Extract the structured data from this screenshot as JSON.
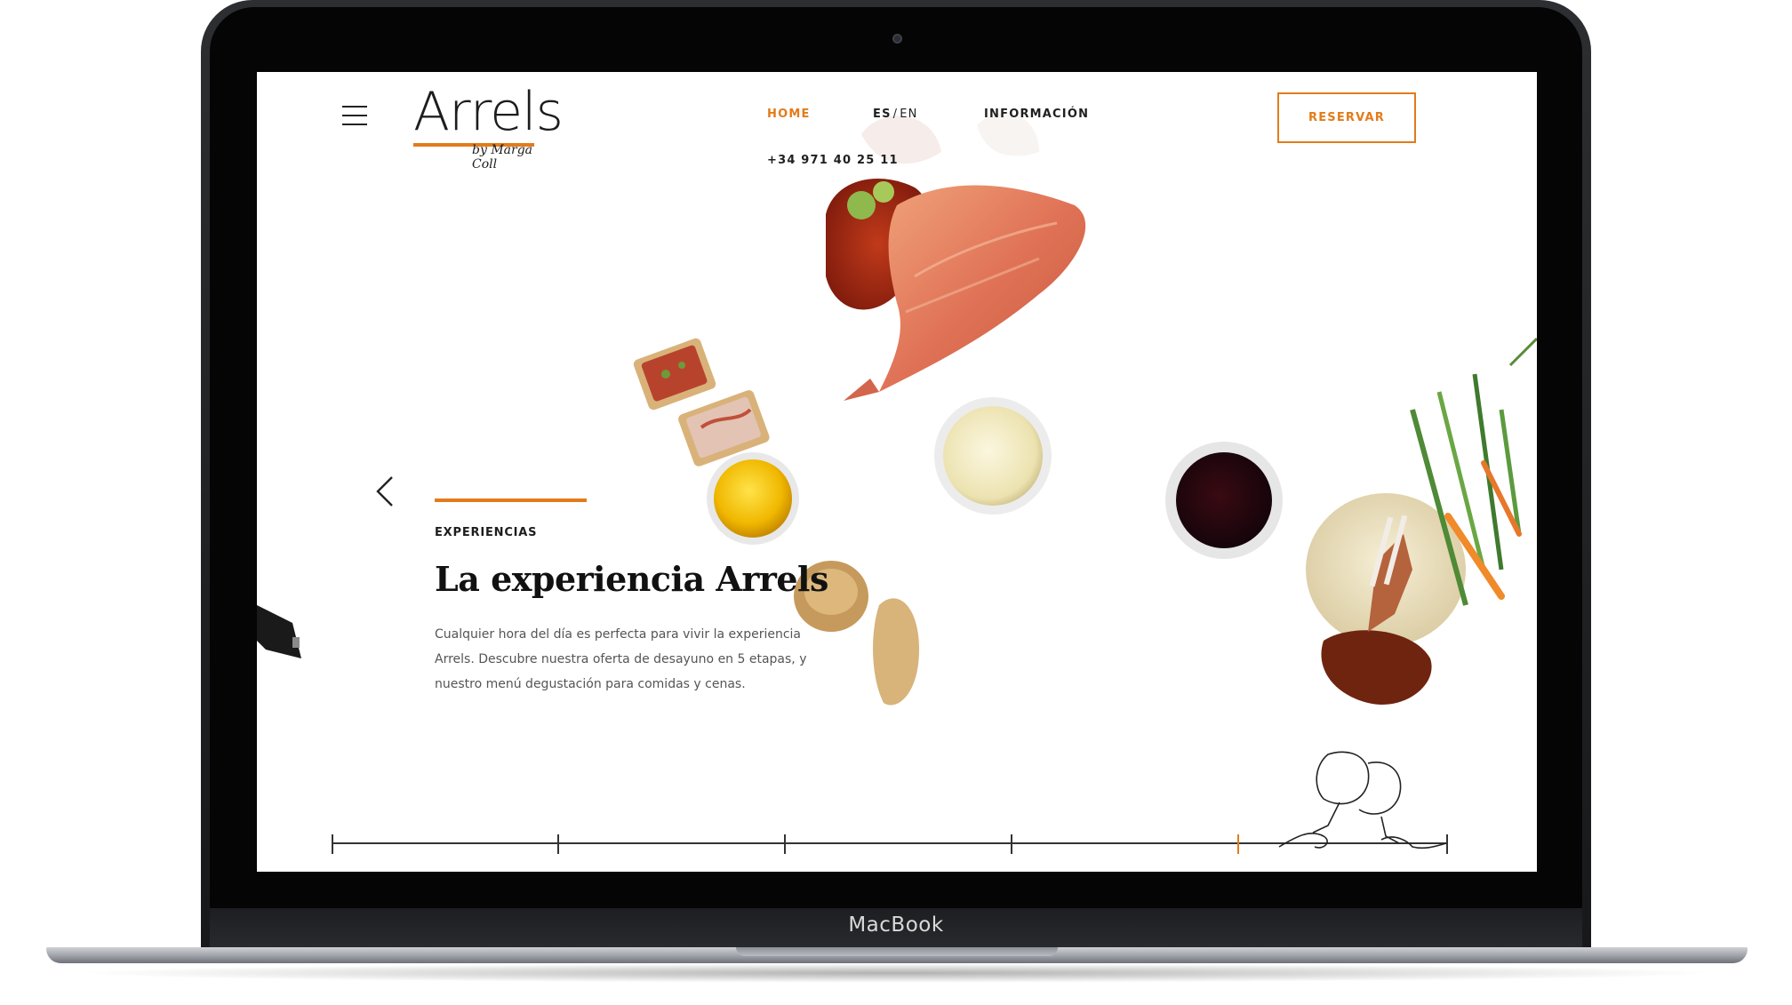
{
  "device": {
    "label": "MacBook"
  },
  "header": {
    "logo": {
      "name": "Arrels",
      "tagline": "by Marga Coll"
    },
    "nav": [
      {
        "label": "HOME",
        "active": true
      },
      {
        "label": "INFORMACIÓN",
        "active": false
      }
    ],
    "languages": {
      "selected": "ES",
      "separator": "/",
      "other": "EN"
    },
    "phone": "+34 971 40 25 11",
    "reserve_label": "RESERVAR"
  },
  "hero": {
    "kicker": "EXPERIENCIAS",
    "title": "La experiencia Arrels",
    "body": "Cualquier hora del día es perfecta para vivir la experiencia Arrels. Descubre nuestra oferta de desayuno en 5 etapas, y nuestro menú degustación para comidas y cenas."
  },
  "colors": {
    "accent": "#e37b1a",
    "text": "#111111",
    "body_text": "#555555"
  },
  "icons": [
    "menu-icon",
    "chevron-left-icon",
    "wine-glasses-icon"
  ],
  "timeline": {
    "steps": 5,
    "active_step": 5
  }
}
